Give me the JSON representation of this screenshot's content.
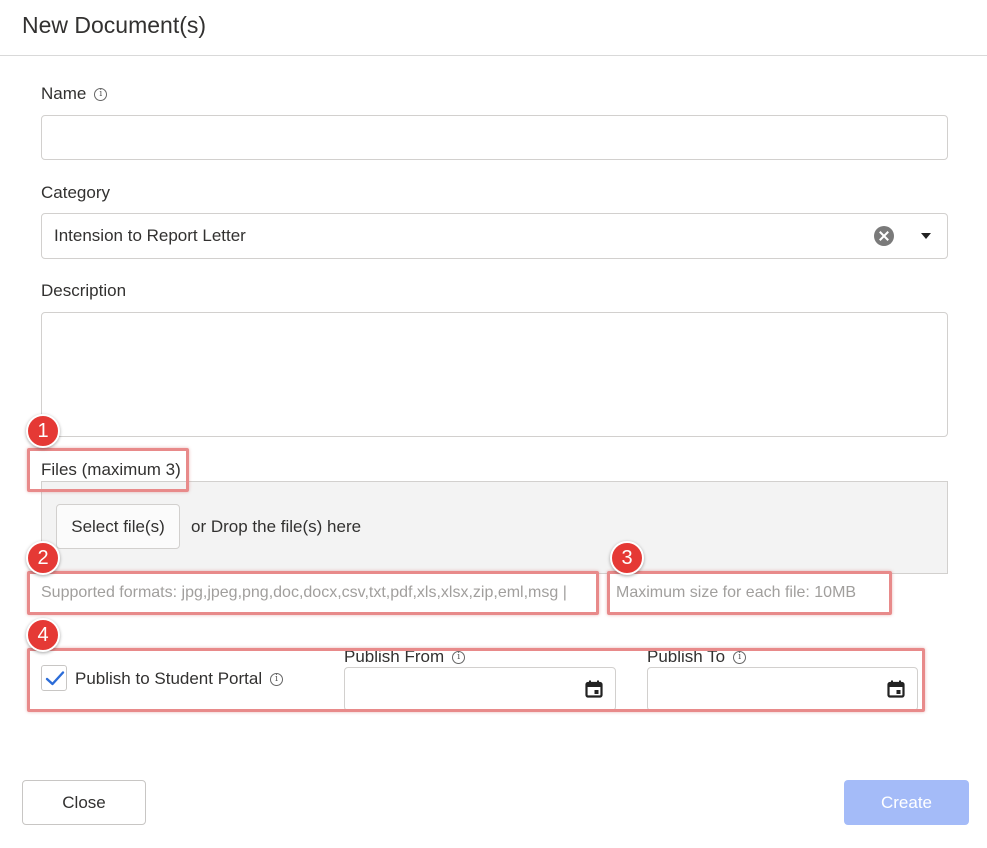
{
  "dialog": {
    "title": "New Document(s)"
  },
  "name_field": {
    "label": "Name",
    "value": "",
    "info_icon": "info-icon"
  },
  "category_field": {
    "label": "Category",
    "value": "Intension to Report Letter",
    "clear_icon": "clear-circle-icon",
    "dropdown_icon": "caret-down-icon"
  },
  "description_field": {
    "label": "Description",
    "value": ""
  },
  "files": {
    "label": "Files (maximum 3)",
    "select_button": "Select file(s)",
    "drop_text": "or Drop the file(s) here",
    "supported_formats": "Supported formats: jpg,jpeg,png,doc,docx,csv,txt,pdf,xls,xlsx,zip,eml,msg |",
    "max_size": "Maximum size for each file: 10MB"
  },
  "publish": {
    "checkbox_label": "Publish to Student Portal",
    "checked": true,
    "from_label": "Publish From",
    "from_value": "",
    "to_label": "Publish To",
    "to_value": ""
  },
  "annotations": [
    "1",
    "2",
    "3",
    "4"
  ],
  "footer": {
    "close_label": "Close",
    "create_label": "Create"
  },
  "colors": {
    "annotation_badge": "#e53935",
    "annotation_border": "#e88a8a",
    "create_disabled": "#a4bbf8",
    "checkmark": "#2b6cd8"
  }
}
